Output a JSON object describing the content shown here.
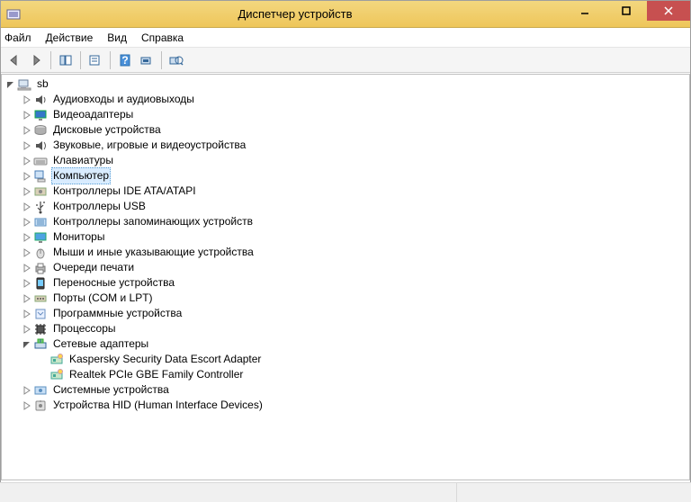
{
  "window": {
    "title": "Диспетчер устройств"
  },
  "menu": {
    "file": "Файл",
    "action": "Действие",
    "view": "Вид",
    "help": "Справка"
  },
  "tree": {
    "root": {
      "label": "sb",
      "icon": "computer",
      "expanded": true,
      "children": [
        {
          "label": "Аудиовходы и аудиовыходы",
          "icon": "audio",
          "expandable": true
        },
        {
          "label": "Видеоадаптеры",
          "icon": "display",
          "expandable": true
        },
        {
          "label": "Дисковые устройства",
          "icon": "disk",
          "expandable": true
        },
        {
          "label": "Звуковые, игровые и видеоустройства",
          "icon": "sound",
          "expandable": true
        },
        {
          "label": "Клавиатуры",
          "icon": "keyboard",
          "expandable": true
        },
        {
          "label": "Компьютер",
          "icon": "pc",
          "expandable": true,
          "selected": true
        },
        {
          "label": "Контроллеры IDE ATA/ATAPI",
          "icon": "ide",
          "expandable": true
        },
        {
          "label": "Контроллеры USB",
          "icon": "usb",
          "expandable": true
        },
        {
          "label": "Контроллеры запоминающих устройств",
          "icon": "storage",
          "expandable": true
        },
        {
          "label": "Мониторы",
          "icon": "monitor",
          "expandable": true
        },
        {
          "label": "Мыши и иные указывающие устройства",
          "icon": "mouse",
          "expandable": true
        },
        {
          "label": "Очереди печати",
          "icon": "printer",
          "expandable": true
        },
        {
          "label": "Переносные устройства",
          "icon": "portable",
          "expandable": true
        },
        {
          "label": "Порты (COM и LPT)",
          "icon": "port",
          "expandable": true
        },
        {
          "label": "Программные устройства",
          "icon": "software",
          "expandable": true
        },
        {
          "label": "Процессоры",
          "icon": "cpu",
          "expandable": true
        },
        {
          "label": "Сетевые адаптеры",
          "icon": "network",
          "expandable": true,
          "expanded": true,
          "children": [
            {
              "label": "Kaspersky Security Data Escort Adapter",
              "icon": "netadapter"
            },
            {
              "label": "Realtek PCIe GBE Family Controller",
              "icon": "netadapter"
            }
          ]
        },
        {
          "label": "Системные устройства",
          "icon": "system",
          "expandable": true
        },
        {
          "label": "Устройства HID (Human Interface Devices)",
          "icon": "hid",
          "expandable": true
        }
      ]
    }
  }
}
